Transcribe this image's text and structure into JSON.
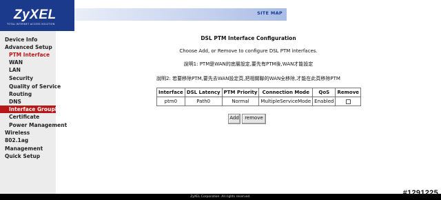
{
  "header": {
    "logo": "ZyXEL",
    "logo_tagline": "TOTAL INTERNET ACCESS SOLUTION",
    "site_map": "SITE MAP",
    "brand_color": "#1c3a8c"
  },
  "sidebar": {
    "items": [
      {
        "label": "Device Info"
      },
      {
        "label": "Advanced Setup"
      },
      {
        "label": "PTM Interface"
      },
      {
        "label": "WAN"
      },
      {
        "label": "LAN"
      },
      {
        "label": "Security"
      },
      {
        "label": "Quality of Service"
      },
      {
        "label": "Routing"
      },
      {
        "label": "DNS"
      },
      {
        "label": "Interface Grouping"
      },
      {
        "label": "Certificate"
      },
      {
        "label": "Power Management"
      },
      {
        "label": "Wireless"
      },
      {
        "label": "802.1ag"
      },
      {
        "label": "Management"
      },
      {
        "label": "Quick Setup"
      }
    ],
    "highlight_color": "#b81818"
  },
  "main": {
    "title": "DSL PTM Interface Configuration",
    "intro": "Choose Add, or Remove to configure DSL PTM interfaces.",
    "note1": "說明1: PTM是WAN的底層設定,要先有PTM後,WAN才能設定",
    "note2": "說明2: 若要移除PTM,要先去WAN設定頁,把相關聯的WAN全移除,才能在此頁移除PTM",
    "table": {
      "headers": [
        "Interface",
        "DSL Latency",
        "PTM Priority",
        "Connection Mode",
        "QoS",
        "Remove"
      ],
      "rows": [
        [
          "ptm0",
          "Path0",
          "Normal",
          "MultipleServiceMode",
          "Enabled"
        ]
      ]
    },
    "buttons": {
      "add": "Add",
      "remove": "remove"
    }
  },
  "footer": {
    "copyright": "ZyXEL Corporation. All rights reserved."
  },
  "watermark": "#1291225"
}
